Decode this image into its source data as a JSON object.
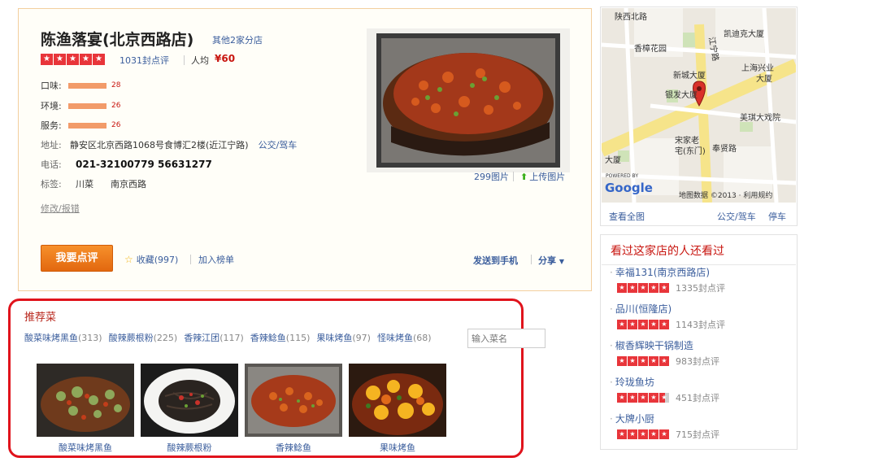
{
  "shop": {
    "name": "陈渔落宴(北京西路店)",
    "branches_link": "其他2家分店",
    "rating_stars": 5,
    "review_count": "1031封点评",
    "avg_label": "人均",
    "avg_price": "¥60",
    "scores": [
      {
        "label": "口味:",
        "value": "28"
      },
      {
        "label": "环境:",
        "value": "26"
      },
      {
        "label": "服务:",
        "value": "26"
      }
    ],
    "address_label": "地址:",
    "address": "静安区北京西路1068号食博汇2楼(近江宁路)",
    "transit_link": "公交/驾车",
    "phone_label": "电话:",
    "phone": "021-32100779 56631277",
    "tags_label": "标签:",
    "tags": [
      "川菜",
      "南京西路"
    ],
    "edit_link": "修改/报错",
    "review_button": "我要点评",
    "favorite": "收藏(997)",
    "add_list": "加入榜单",
    "send_to_phone": "发送到手机",
    "share": "分享",
    "photo_count": "299图片",
    "upload_photo": "上传图片"
  },
  "recommended": {
    "title": "推荐菜",
    "search_placeholder": "输入菜名",
    "tags": [
      {
        "name": "酸菜味烤黑鱼",
        "count": "(313)"
      },
      {
        "name": "酸辣蕨根粉",
        "count": "(225)"
      },
      {
        "name": "香辣江团",
        "count": "(117)"
      },
      {
        "name": "香辣鲶鱼",
        "count": "(115)"
      },
      {
        "name": "果味烤鱼",
        "count": "(97)"
      },
      {
        "name": "怪味烤鱼",
        "count": "(68)"
      }
    ],
    "dishes": [
      {
        "name": "酸菜味烤黑鱼"
      },
      {
        "name": "酸辣蕨根粉"
      },
      {
        "name": "香辣鲶鱼"
      },
      {
        "name": "果味烤鱼"
      }
    ]
  },
  "map": {
    "labels": [
      "陕西北路",
      "江宁路",
      "凯迪克大厦",
      "香樟花园",
      "上海兴业",
      "大厦",
      "新城大厦",
      "银发大厦",
      "美琪大戏院",
      "宋家老",
      "宅(东门)",
      "奉贤路",
      "大厦"
    ],
    "google_powered": "POWERED BY",
    "google": "Google",
    "copyright": "地图数据 ©2013 · 利用规约",
    "view_all": "查看全图",
    "transit": "公交/驾车",
    "parking": "停车"
  },
  "also_viewed": {
    "title": "看过这家店的人还看过",
    "items": [
      {
        "name": "幸福131(南京西路店)",
        "stars": 5,
        "reviews": "1335封点评"
      },
      {
        "name": "品川(恒隆店)",
        "stars": 5,
        "reviews": "1143封点评"
      },
      {
        "name": "椒香辉映干锅制造",
        "stars": 5,
        "reviews": "983封点评"
      },
      {
        "name": "玲珑鱼坊",
        "stars": 4.5,
        "reviews": "451封点评"
      },
      {
        "name": "大牌小厨",
        "stars": 5,
        "reviews": "715封点评"
      }
    ]
  },
  "colors": {
    "accent_red": "#c8150f",
    "link_blue": "#3a5d9c",
    "button_orange": "#f28a21",
    "highlight_border": "#e0131c"
  }
}
